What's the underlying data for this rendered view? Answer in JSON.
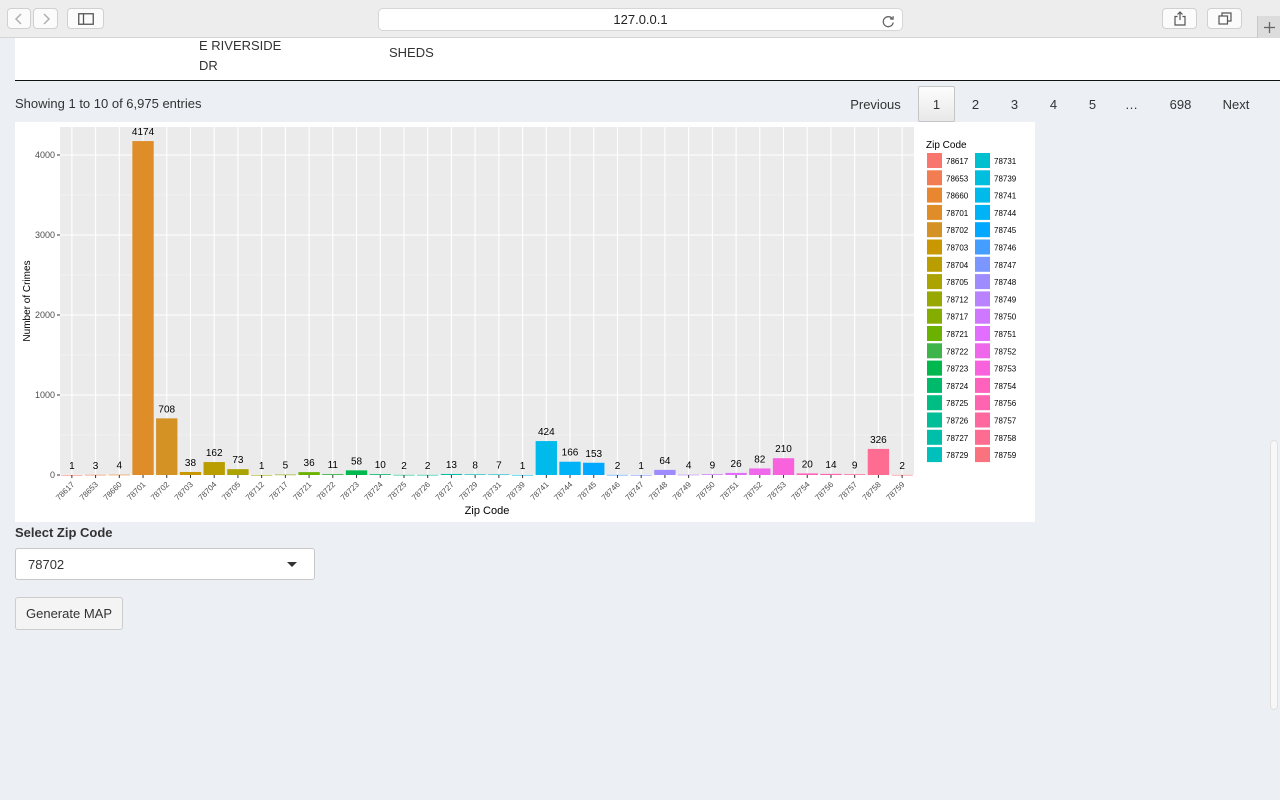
{
  "browser": {
    "url": "127.0.0.1",
    "icons": [
      "back-icon",
      "forward-icon",
      "sidebar-icon",
      "reload-icon",
      "share-icon",
      "tabs-icon",
      "plus-icon"
    ]
  },
  "table_tail": {
    "address_line1": "E RIVERSIDE",
    "address_line2": "DR",
    "location_type": "SHEDS"
  },
  "table_info": "Showing 1 to 10 of 6,975 entries",
  "pagination": {
    "previous": "Previous",
    "pages": [
      "1",
      "2",
      "3",
      "4",
      "5",
      "…",
      "698"
    ],
    "current": "1",
    "next": "Next"
  },
  "controls": {
    "select_label": "Select Zip Code",
    "selected_zip": "78702",
    "button_label": "Generate MAP"
  },
  "chart_data": {
    "type": "bar",
    "xlabel": "Zip Code",
    "ylabel": "Number of Crimes",
    "ylim": [
      0,
      4350
    ],
    "yticks": [
      0,
      1000,
      2000,
      3000,
      4000
    ],
    "grid": true,
    "legend_title": "Zip Code",
    "legend_position": "right",
    "categories": [
      "78617",
      "78653",
      "78660",
      "78701",
      "78702",
      "78703",
      "78704",
      "78705",
      "78712",
      "78717",
      "78721",
      "78722",
      "78723",
      "78724",
      "78725",
      "78726",
      "78727",
      "78729",
      "78731",
      "78739",
      "78741",
      "78744",
      "78745",
      "78746",
      "78747",
      "78748",
      "78749",
      "78750",
      "78751",
      "78752",
      "78753",
      "78754",
      "78756",
      "78757",
      "78758",
      "78759"
    ],
    "values": [
      1,
      3,
      4,
      4174,
      708,
      38,
      162,
      73,
      1,
      5,
      36,
      11,
      58,
      10,
      2,
      2,
      13,
      8,
      7,
      1,
      424,
      166,
      153,
      2,
      1,
      64,
      4,
      9,
      26,
      82,
      210,
      20,
      14,
      9,
      326,
      2
    ],
    "colors": [
      "#F8766D",
      "#F27D52",
      "#E98731",
      "#DF8D29",
      "#D49225",
      "#C99800",
      "#BA9E00",
      "#AAA300",
      "#99A800",
      "#85AD00",
      "#6BB100",
      "#3DB54B",
      "#00B84D",
      "#00BA6B",
      "#00BD83",
      "#00BE97",
      "#00BFAA",
      "#00C0BC",
      "#00BFCE",
      "#00BEDD",
      "#00BAEB",
      "#00B3F6",
      "#00A9FF",
      "#449EFF",
      "#7C96FF",
      "#9E8CFF",
      "#B983FF",
      "#CF78FF",
      "#E16EFF",
      "#EF67EB",
      "#F962DD",
      "#FF62BD",
      "#FF64B0",
      "#FF689F",
      "#FF6C91",
      "#FB727F"
    ]
  }
}
